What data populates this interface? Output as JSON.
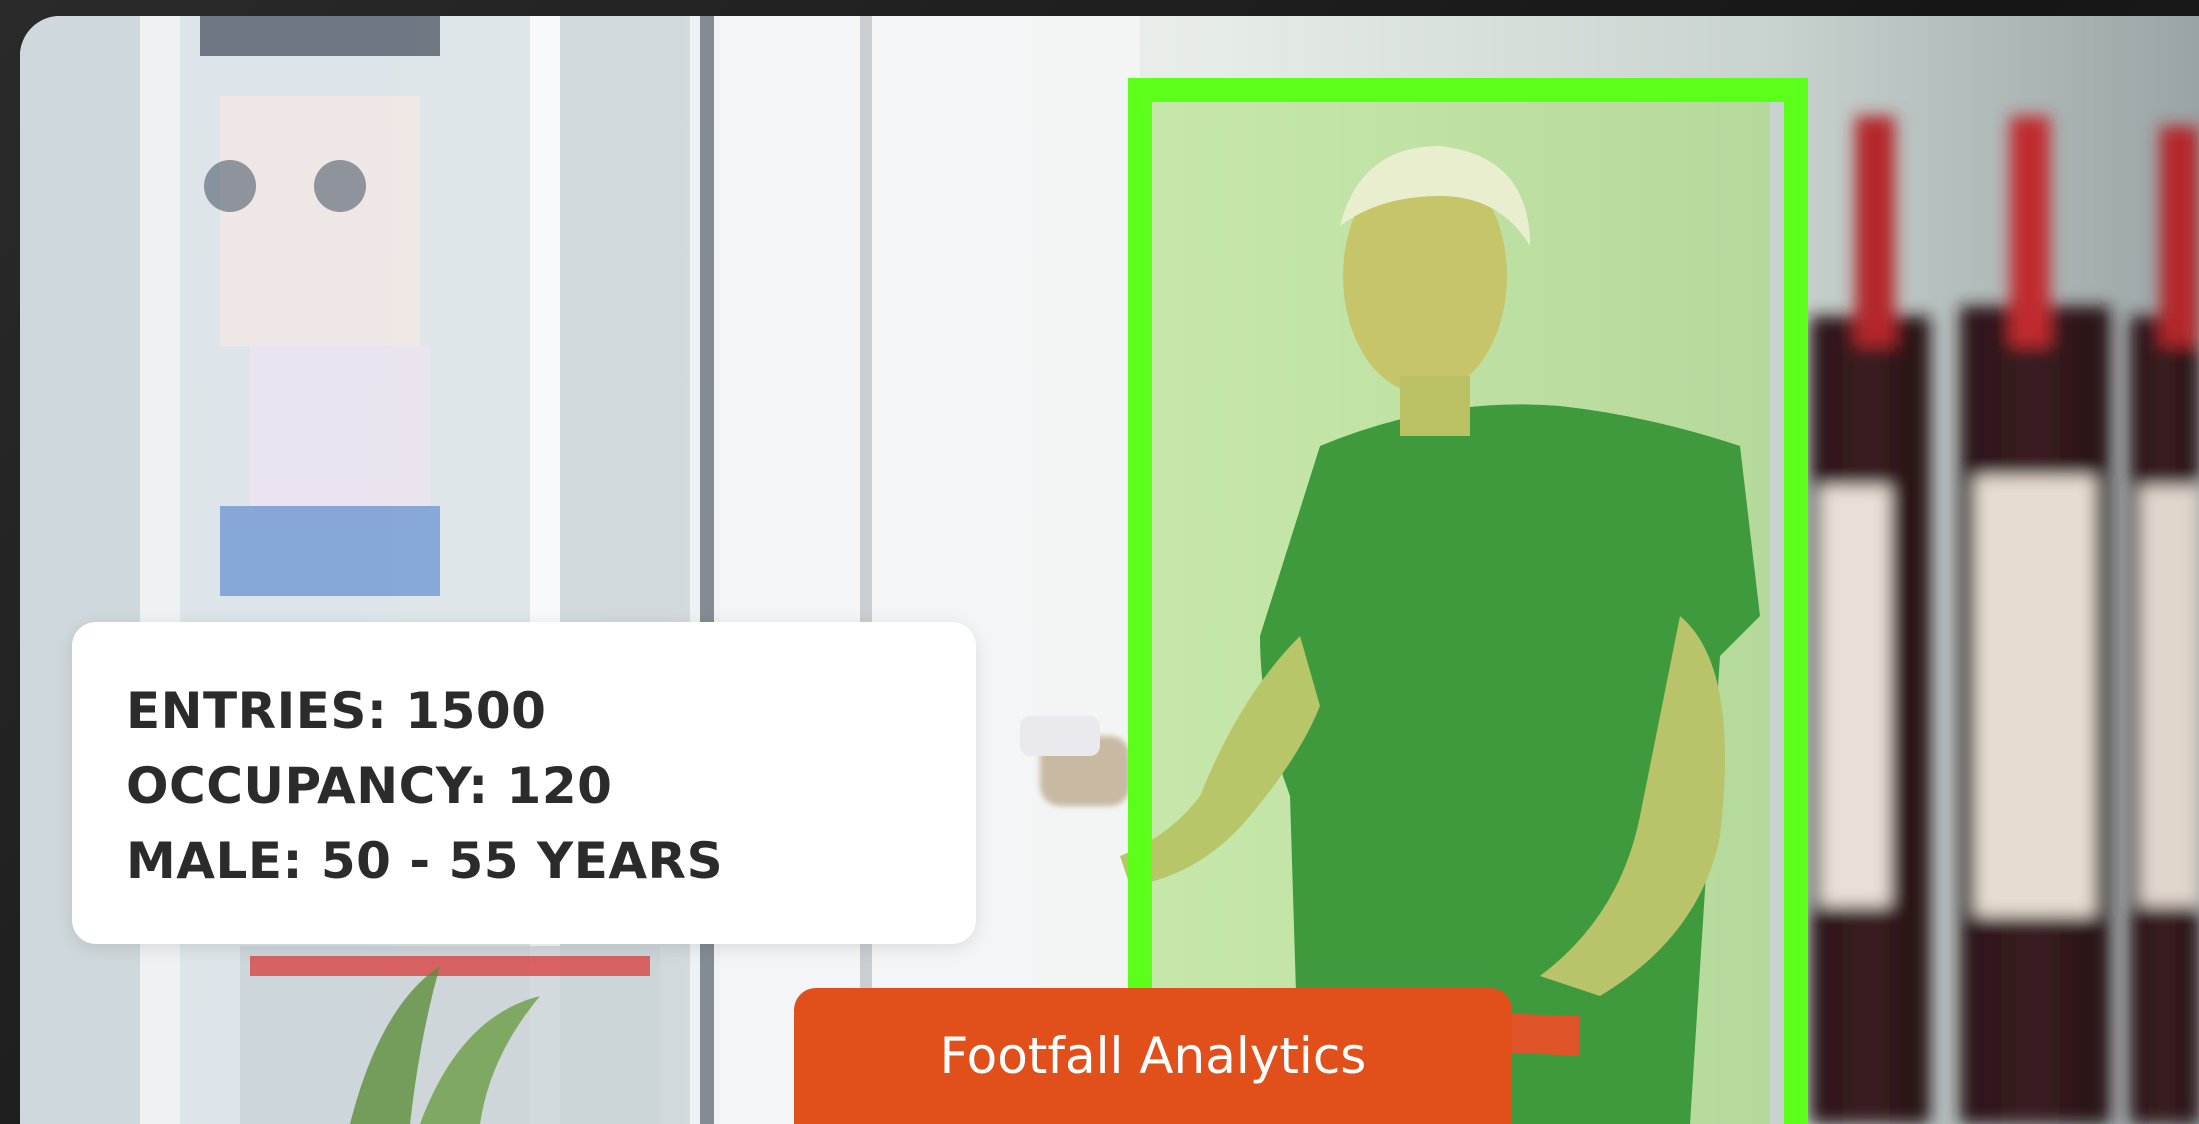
{
  "stats": {
    "entries": "ENTRIES: 1500",
    "occupancy": "OCCUPANCY: 120",
    "demographic": "MALE: 50 - 55 YEARS"
  },
  "cta": {
    "label": "Footfall Analytics"
  },
  "colors": {
    "detection_box": "#5cff1a",
    "cta_background": "#e14f1a",
    "stats_text": "#2b2b2b",
    "panel_background": "#ffffff"
  },
  "icons": [
    "person-detection-box"
  ]
}
